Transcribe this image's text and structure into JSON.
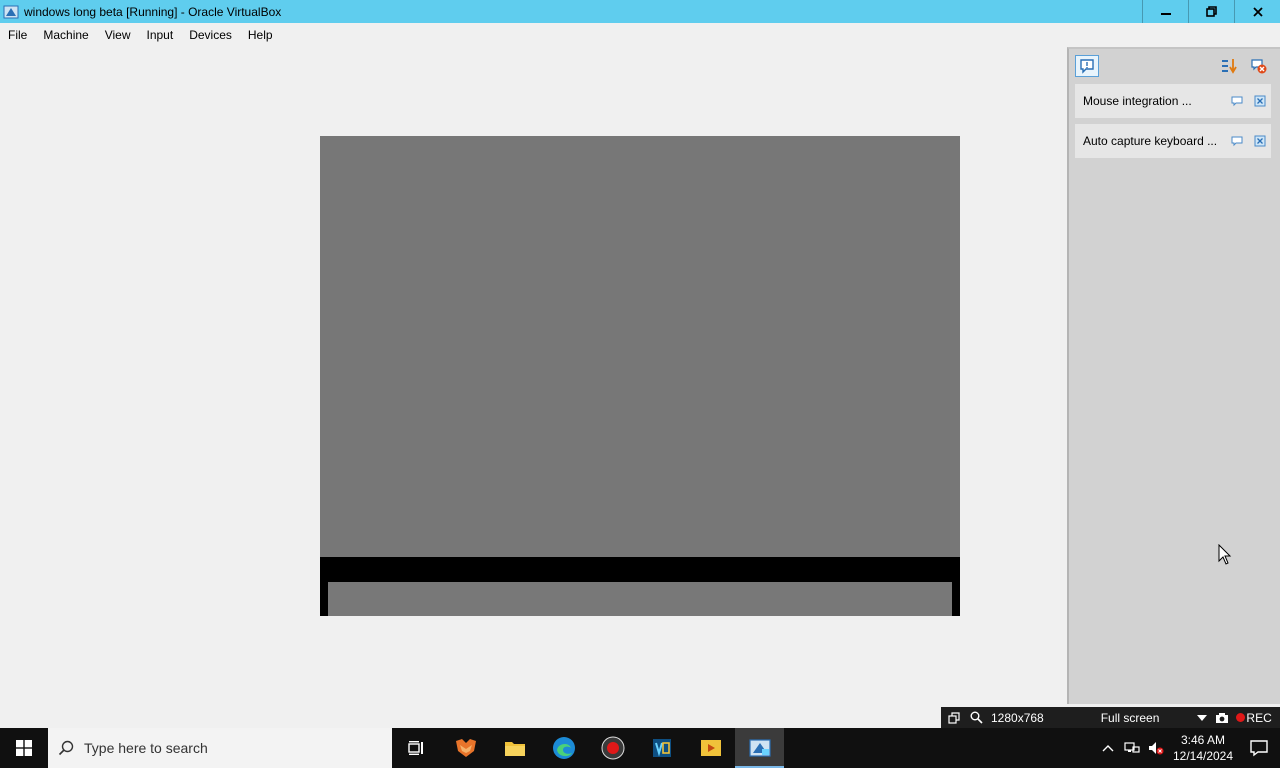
{
  "window": {
    "title": "windows long beta [Running] - Oracle VirtualBox",
    "app_icon": "virtualbox-icon",
    "controls": {
      "minimize": "minimize-icon",
      "restore": "restore-icon",
      "close": "close-icon"
    }
  },
  "menubar": {
    "items": [
      {
        "label": "File"
      },
      {
        "label": "Machine"
      },
      {
        "label": "View"
      },
      {
        "label": "Input"
      },
      {
        "label": "Devices"
      },
      {
        "label": "Help"
      }
    ]
  },
  "notification_center": {
    "items": [
      {
        "label": "Mouse integration ..."
      },
      {
        "label": "Auto capture keyboard ..."
      }
    ]
  },
  "statusbar": {
    "resolution": "1280x768",
    "scaling_mode": "Full screen",
    "recording": "REC"
  },
  "taskbar": {
    "search_placeholder": "Type here to search",
    "clock_time": "3:46 AM",
    "clock_date": "12/14/2024"
  },
  "colors": {
    "titlebar": "#5fcdee",
    "vm_screen": "#777777",
    "taskbar": "#101010"
  }
}
